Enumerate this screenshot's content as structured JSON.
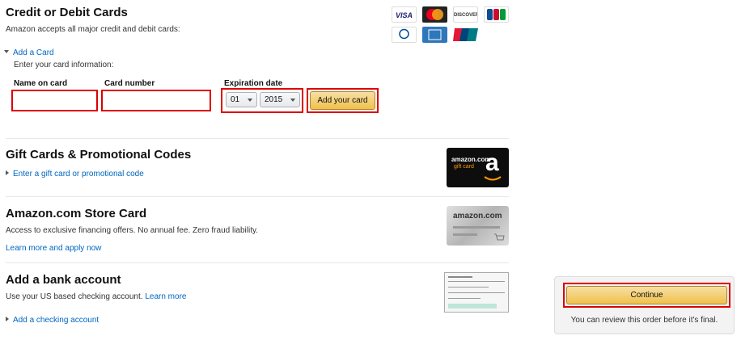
{
  "cards": {
    "title": "Credit or Debit Cards",
    "subtitle": "Amazon accepts all major credit and debit cards:",
    "add_card_link": "Add a Card",
    "enter_info": "Enter your card information:",
    "name_label": "Name on card",
    "number_label": "Card number",
    "exp_label": "Expiration date",
    "exp_month": "01",
    "exp_year": "2015",
    "add_button": "Add your card",
    "brands": [
      "VISA",
      "MasterCard",
      "DISCOVER",
      "JCB",
      "Diners Club",
      "AMEX",
      "UnionPay"
    ]
  },
  "gift": {
    "title": "Gift Cards & Promotional Codes",
    "link": "Enter a gift card or promotional code",
    "card_text": "amazon.com",
    "card_sub": "gift card",
    "card_letter": "a"
  },
  "store": {
    "title": "Amazon.com Store Card",
    "subtitle": "Access to exclusive financing offers. No annual fee. Zero fraud liability.",
    "link": "Learn more and apply now",
    "card_text": "amazon.com"
  },
  "bank": {
    "title": "Add a bank account",
    "subtitle": "Use your US based checking account.",
    "learn_more": "Learn more",
    "link": "Add a checking account"
  },
  "sidebar": {
    "continue_label": "Continue",
    "note": "You can review this order before it's final."
  },
  "colors": {
    "link": "#0066c0",
    "highlight": "#dd0000",
    "button_yellow": "#f0c14b"
  }
}
